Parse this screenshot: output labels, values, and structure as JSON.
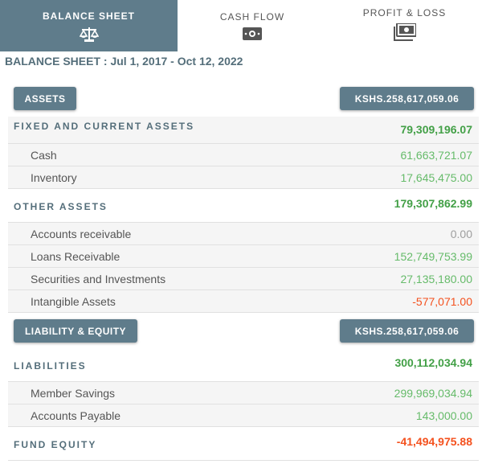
{
  "tabs": [
    {
      "label": "BALANCE SHEET",
      "icon": "scale-icon",
      "active": true
    },
    {
      "label": "CASH FLOW",
      "icon": "cash-icon",
      "active": false
    },
    {
      "label": "PROFIT & LOSS",
      "icon": "money-stack-icon",
      "active": false
    }
  ],
  "period": {
    "prefix": "BALANCE SHEET :",
    "range": "Jul 1, 2017 - Oct 12, 2022"
  },
  "assets": {
    "button_label": "ASSETS",
    "total": "KSHS.258,617,059.06",
    "groups": [
      {
        "label": "FIXED AND CURRENT ASSETS",
        "value": "79,309,196.07",
        "items": [
          {
            "label": "Cash",
            "value": "61,663,721.07"
          },
          {
            "label": "Inventory",
            "value": "17,645,475.00"
          }
        ]
      },
      {
        "label": "OTHER ASSETS",
        "value": "179,307,862.99",
        "items": [
          {
            "label": "Accounts receivable",
            "value": "0.00"
          },
          {
            "label": "Loans Receivable",
            "value": "152,749,753.99"
          },
          {
            "label": "Securities and Investments",
            "value": "27,135,180.00"
          },
          {
            "label": "Intangible Assets",
            "value": "-577,071.00"
          }
        ]
      }
    ]
  },
  "liability_equity": {
    "button_label": "LIABILITY & EQUITY",
    "total": "KSHS.258,617,059.06",
    "groups": [
      {
        "label": "LIABILITIES",
        "value": "300,112,034.94",
        "items": [
          {
            "label": "Member Savings",
            "value": "299,969,034.94"
          },
          {
            "label": "Accounts Payable",
            "value": "143,000.00"
          }
        ]
      },
      {
        "label": "FUND EQUITY",
        "value": "-41,494,975.88",
        "items": []
      }
    ]
  },
  "colors": {
    "accent": "#5f7c8b",
    "positive": "#43a047",
    "negative": "#f4511e",
    "zero": "#9e9e9e"
  }
}
